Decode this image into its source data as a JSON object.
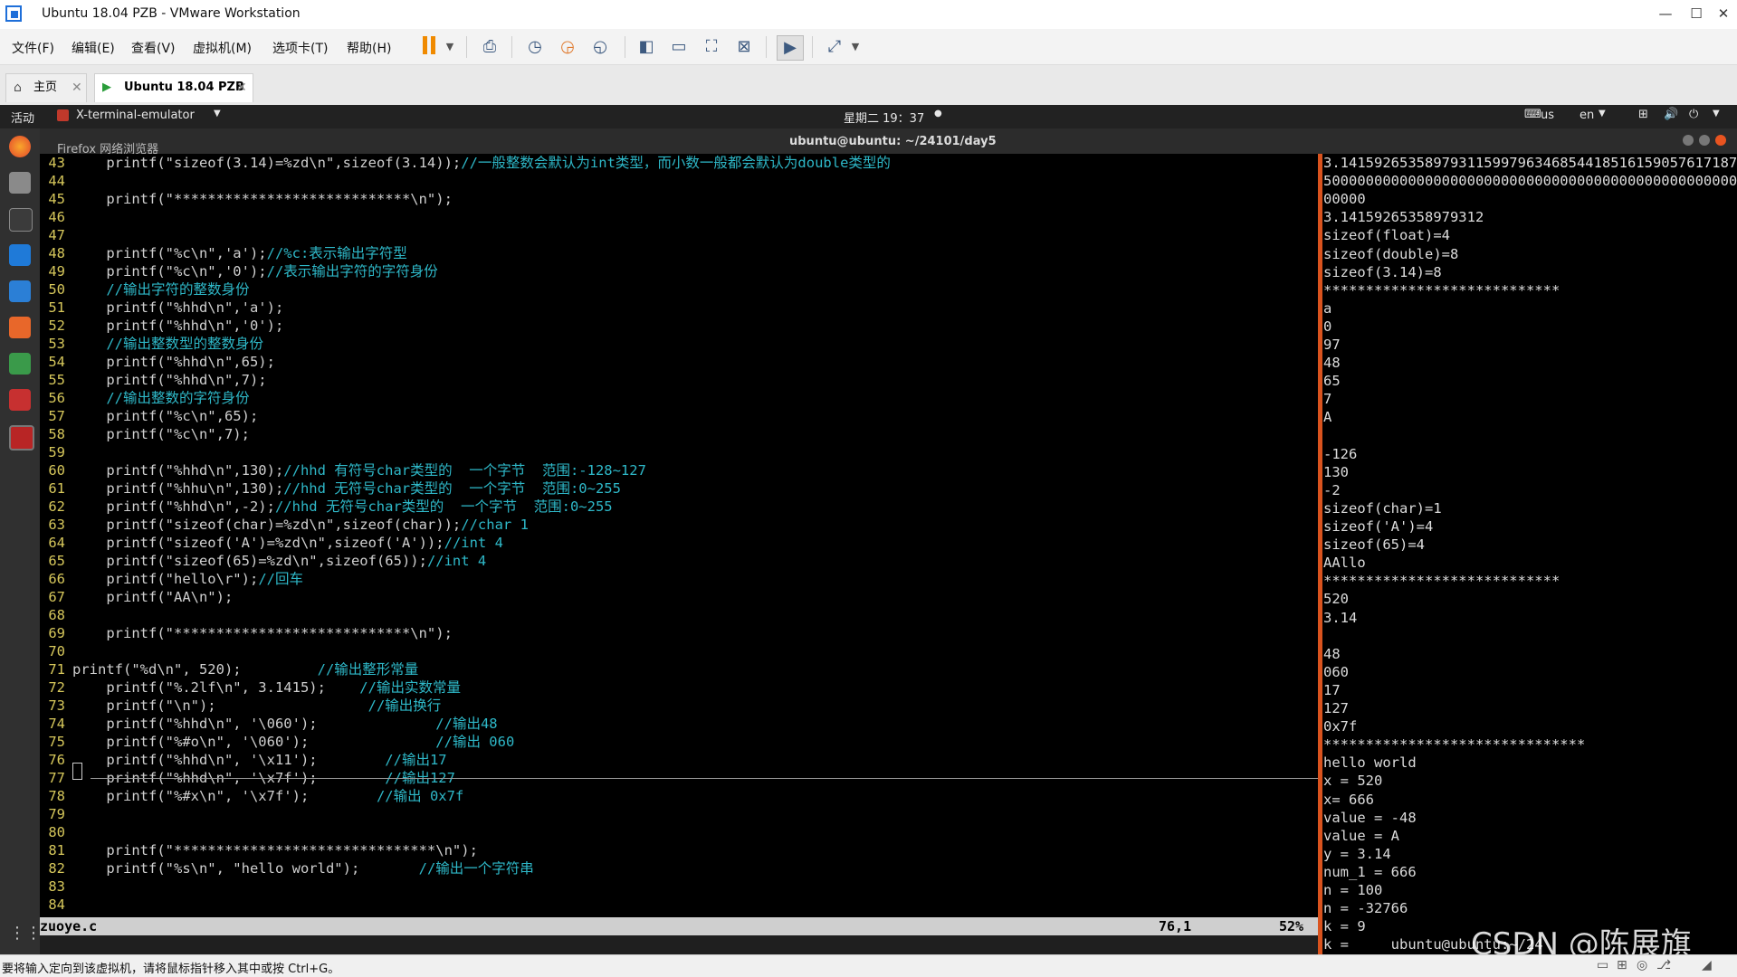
{
  "window": {
    "title": "Ubuntu 18.04 PZB - VMware Workstation",
    "minimize": "—",
    "restore": "☐",
    "close": "✕"
  },
  "menu": [
    "文件(F)",
    "编辑(E)",
    "查看(V)",
    "虚拟机(M)",
    "选项卡(T)",
    "帮助(H)"
  ],
  "toolbar_icons": [
    "pause-icon",
    "send-ctrl-alt-del-icon",
    "snapshot-icon",
    "revert-snapshot-icon",
    "snapshot-manager-icon",
    "sidebar-icon",
    "thumbnail-bar-icon",
    "fit-guest-icon",
    "unity-icon",
    "console-view-icon",
    "fullscreen-icon"
  ],
  "tabs": {
    "home": "主页",
    "vm": "Ubuntu 18.04 PZB"
  },
  "gnome": {
    "activities": "活动",
    "app_name": "X-terminal-emulator",
    "clock": "星期二 19：37",
    "keyboard": "us",
    "lang": "en"
  },
  "terminal": {
    "title": "ubuntu@ubuntu: ~/24101/day5",
    "firefox_tooltip": "Firefox 网络浏览器"
  },
  "code_lines": [
    {
      "n": "43",
      "code": "    printf(\"sizeof(3.14)=%zd\\n\",sizeof(3.14));",
      "comment": "//一般整数会默认为int类型，而小数一般都会默认为double类型的"
    },
    {
      "n": "44",
      "code": "",
      "comment": ""
    },
    {
      "n": "45",
      "code": "    printf(\"****************************\\n\");",
      "comment": ""
    },
    {
      "n": "46",
      "code": "",
      "comment": ""
    },
    {
      "n": "47",
      "code": "",
      "comment": ""
    },
    {
      "n": "48",
      "code": "    printf(\"%c\\n\",'a');",
      "comment": "//%c:表示输出字符型"
    },
    {
      "n": "49",
      "code": "    printf(\"%c\\n\",'0');",
      "comment": "//表示输出字符的字符身份"
    },
    {
      "n": "50",
      "code": "    ",
      "comment": "//输出字符的整数身份"
    },
    {
      "n": "51",
      "code": "    printf(\"%hhd\\n\",'a');",
      "comment": ""
    },
    {
      "n": "52",
      "code": "    printf(\"%hhd\\n\",'0');",
      "comment": ""
    },
    {
      "n": "53",
      "code": "    ",
      "comment": "//输出整数型的整数身份"
    },
    {
      "n": "54",
      "code": "    printf(\"%hhd\\n\",65);",
      "comment": ""
    },
    {
      "n": "55",
      "code": "    printf(\"%hhd\\n\",7);",
      "comment": ""
    },
    {
      "n": "56",
      "code": "    ",
      "comment": "//输出整数的字符身份"
    },
    {
      "n": "57",
      "code": "    printf(\"%c\\n\",65);",
      "comment": ""
    },
    {
      "n": "58",
      "code": "    printf(\"%c\\n\",7);",
      "comment": ""
    },
    {
      "n": "59",
      "code": "",
      "comment": ""
    },
    {
      "n": "60",
      "code": "    printf(\"%hhd\\n\",130);",
      "comment": "//hhd 有符号char类型的  一个字节  范围:-128~127"
    },
    {
      "n": "61",
      "code": "    printf(\"%hhu\\n\",130);",
      "comment": "//hhd 无符号char类型的  一个字节  范围:0~255"
    },
    {
      "n": "62",
      "code": "    printf(\"%hhd\\n\",-2);",
      "comment": "//hhd 无符号char类型的  一个字节  范围:0~255"
    },
    {
      "n": "63",
      "code": "    printf(\"sizeof(char)=%zd\\n\",sizeof(char));",
      "comment": "//char 1"
    },
    {
      "n": "64",
      "code": "    printf(\"sizeof('A')=%zd\\n\",sizeof('A'));",
      "comment": "//int 4"
    },
    {
      "n": "65",
      "code": "    printf(\"sizeof(65)=%zd\\n\",sizeof(65));",
      "comment": "//int 4"
    },
    {
      "n": "66",
      "code": "    printf(\"hello\\r\");",
      "comment": "//回车"
    },
    {
      "n": "67",
      "code": "    printf(\"AA\\n\");",
      "comment": ""
    },
    {
      "n": "68",
      "code": "",
      "comment": ""
    },
    {
      "n": "69",
      "code": "    printf(\"****************************\\n\");",
      "comment": ""
    },
    {
      "n": "70",
      "code": "",
      "comment": ""
    },
    {
      "n": "71",
      "code": "printf(\"%d\\n\", 520);         ",
      "comment": "//输出整形常量"
    },
    {
      "n": "72",
      "code": "    printf(\"%.2lf\\n\", 3.1415);    ",
      "comment": "//输出实数常量"
    },
    {
      "n": "73",
      "code": "    printf(\"\\n\");                  ",
      "comment": "//输出换行"
    },
    {
      "n": "74",
      "code": "    printf(\"%hhd\\n\", '\\060');              ",
      "comment": "//输出48"
    },
    {
      "n": "75",
      "code": "    printf(\"%#o\\n\", '\\060');               ",
      "comment": "//输出 060"
    },
    {
      "n": "76",
      "code": "    printf(\"%hhd\\n\", '\\x11');        ",
      "comment": "//输出17"
    },
    {
      "n": "77",
      "code": "    printf(\"%hhd\\n\", '\\x7f');        ",
      "comment": "//输出127"
    },
    {
      "n": "78",
      "code": "    printf(\"%#x\\n\", '\\x7f');        ",
      "comment": "//输出 0x7f"
    },
    {
      "n": "79",
      "code": "",
      "comment": ""
    },
    {
      "n": "80",
      "code": "",
      "comment": ""
    },
    {
      "n": "81",
      "code": "    printf(\"*******************************\\n\");",
      "comment": ""
    },
    {
      "n": "82",
      "code": "    printf(\"%s\\n\", \"hello world\");       ",
      "comment": "//输出一个字符串"
    },
    {
      "n": "83",
      "code": "",
      "comment": ""
    },
    {
      "n": "84",
      "code": "",
      "comment": ""
    }
  ],
  "vim_status": {
    "file": "zuoye.c",
    "pos": "76,1",
    "percent": "52%"
  },
  "output_lines": [
    "3.14159265358979311599796346854418516159057617187",
    "5000000000000000000000000000000000000000000000000",
    "00000",
    "3.14159265358979312",
    "sizeof(float)=4",
    "sizeof(double)=8",
    "sizeof(3.14)=8",
    "****************************",
    "a",
    "0",
    "97",
    "48",
    "65",
    "7",
    "A",
    "",
    "-126",
    "130",
    "-2",
    "sizeof(char)=1",
    "sizeof('A')=4",
    "sizeof(65)=4",
    "AAllo",
    "****************************",
    "520",
    "3.14",
    "",
    "48",
    "060",
    "17",
    "127",
    "0x7f",
    "*******************************",
    "hello world",
    "x = 520",
    "x= 666",
    "value = -48",
    "value = A",
    "y = 3.14",
    "num_1 = 666",
    "n = 100",
    "n = -32766",
    "k = 9",
    "k =     ubuntu@ubuntu:~/24"
  ],
  "status": {
    "message": "要将输入定向到该虚拟机，请将鼠标指针移入其中或按 Ctrl+G。"
  },
  "watermark": "CSDN @陈展旗"
}
